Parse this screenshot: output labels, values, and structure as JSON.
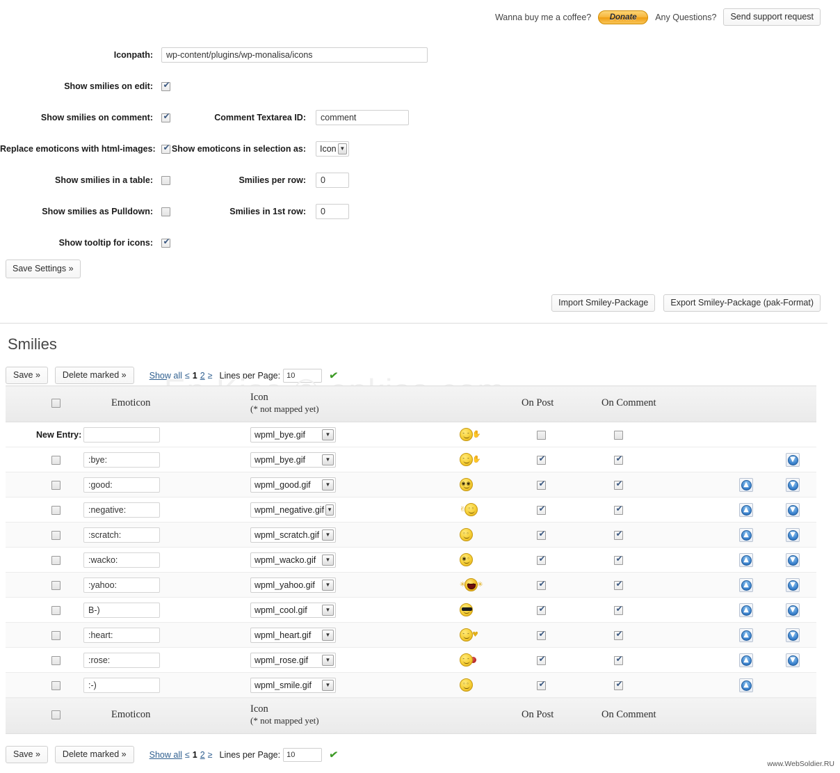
{
  "topbar": {
    "coffee_text": "Wanna buy me a coffee?",
    "donate_label": "Donate",
    "questions_text": "Any Questions?",
    "support_label": "Send support request"
  },
  "settings": {
    "iconpath_label": "Iconpath:",
    "iconpath_value": "wp-content/plugins/wp-monalisa/icons",
    "show_on_edit_label": "Show smilies on edit:",
    "show_on_edit_checked": true,
    "show_on_comment_label": "Show smilies on comment:",
    "show_on_comment_checked": true,
    "comment_textarea_label": "Comment Textarea ID:",
    "comment_textarea_value": "comment",
    "replace_html_label": "Replace emoticons with html-images:",
    "replace_html_checked": true,
    "selection_as_label": "Show emoticons in selection as:",
    "selection_as_value": "Icon",
    "show_table_label": "Show smilies in a table:",
    "show_table_checked": false,
    "per_row_label": "Smilies per row:",
    "per_row_value": "0",
    "pulldown_label": "Show smilies as Pulldown:",
    "pulldown_checked": false,
    "first_row_label": "Smilies in 1st row:",
    "first_row_value": "0",
    "tooltip_label": "Show tooltip for icons:",
    "tooltip_checked": true,
    "save_settings_label": "Save Settings »"
  },
  "package": {
    "import_label": "Import Smiley-Package",
    "export_label": "Export Smiley-Package (pak-Format)"
  },
  "smilies": {
    "title": "Smilies",
    "watermark": "En Kisa © enkisa.com",
    "toolbar": {
      "save_label": "Save »",
      "delete_label": "Delete marked »",
      "show_all_label": "Show all",
      "prev_label": "≤",
      "page_current": "1",
      "page_next": "2",
      "next_label": "≥",
      "lines_per_page_label": "Lines per Page:",
      "lines_per_page_value": "10",
      "ok_icon": "✔"
    },
    "columns": {
      "emoticon": "Emoticon",
      "icon": "Icon",
      "icon_note": "(* not mapped yet)",
      "on_post": "On Post",
      "on_comment": "On Comment"
    },
    "new_entry_label": "New Entry:",
    "new_entry": {
      "emoticon": "",
      "icon": "wpml_bye.gif",
      "on_post": false,
      "on_comment": false
    },
    "rows": [
      {
        "emoticon": ":bye:",
        "icon": "wpml_bye.gif",
        "on_post": true,
        "on_comment": true,
        "up": false,
        "down": true
      },
      {
        "emoticon": ":good:",
        "icon": "wpml_good.gif",
        "on_post": true,
        "on_comment": true,
        "up": true,
        "down": true
      },
      {
        "emoticon": ":negative:",
        "icon": "wpml_negative.gif",
        "on_post": true,
        "on_comment": true,
        "up": true,
        "down": true
      },
      {
        "emoticon": ":scratch:",
        "icon": "wpml_scratch.gif",
        "on_post": true,
        "on_comment": true,
        "up": true,
        "down": true
      },
      {
        "emoticon": ":wacko:",
        "icon": "wpml_wacko.gif",
        "on_post": true,
        "on_comment": true,
        "up": true,
        "down": true
      },
      {
        "emoticon": ":yahoo:",
        "icon": "wpml_yahoo.gif",
        "on_post": true,
        "on_comment": true,
        "up": true,
        "down": true
      },
      {
        "emoticon": "B-)",
        "icon": "wpml_cool.gif",
        "on_post": true,
        "on_comment": true,
        "up": true,
        "down": true
      },
      {
        "emoticon": ":heart:",
        "icon": "wpml_heart.gif",
        "on_post": true,
        "on_comment": true,
        "up": true,
        "down": true
      },
      {
        "emoticon": ":rose:",
        "icon": "wpml_rose.gif",
        "on_post": true,
        "on_comment": true,
        "up": true,
        "down": true
      },
      {
        "emoticon": ":-)",
        "icon": "wpml_smile.gif",
        "on_post": true,
        "on_comment": true,
        "up": true,
        "down": false
      }
    ]
  },
  "footer": {
    "credit": "www.WebSoldier.RU"
  },
  "colors": {
    "link": "#2f5f8f",
    "donate_orange": "#f7b63c",
    "check_green": "#3f9b28",
    "header_bg": "#eeeeee"
  }
}
